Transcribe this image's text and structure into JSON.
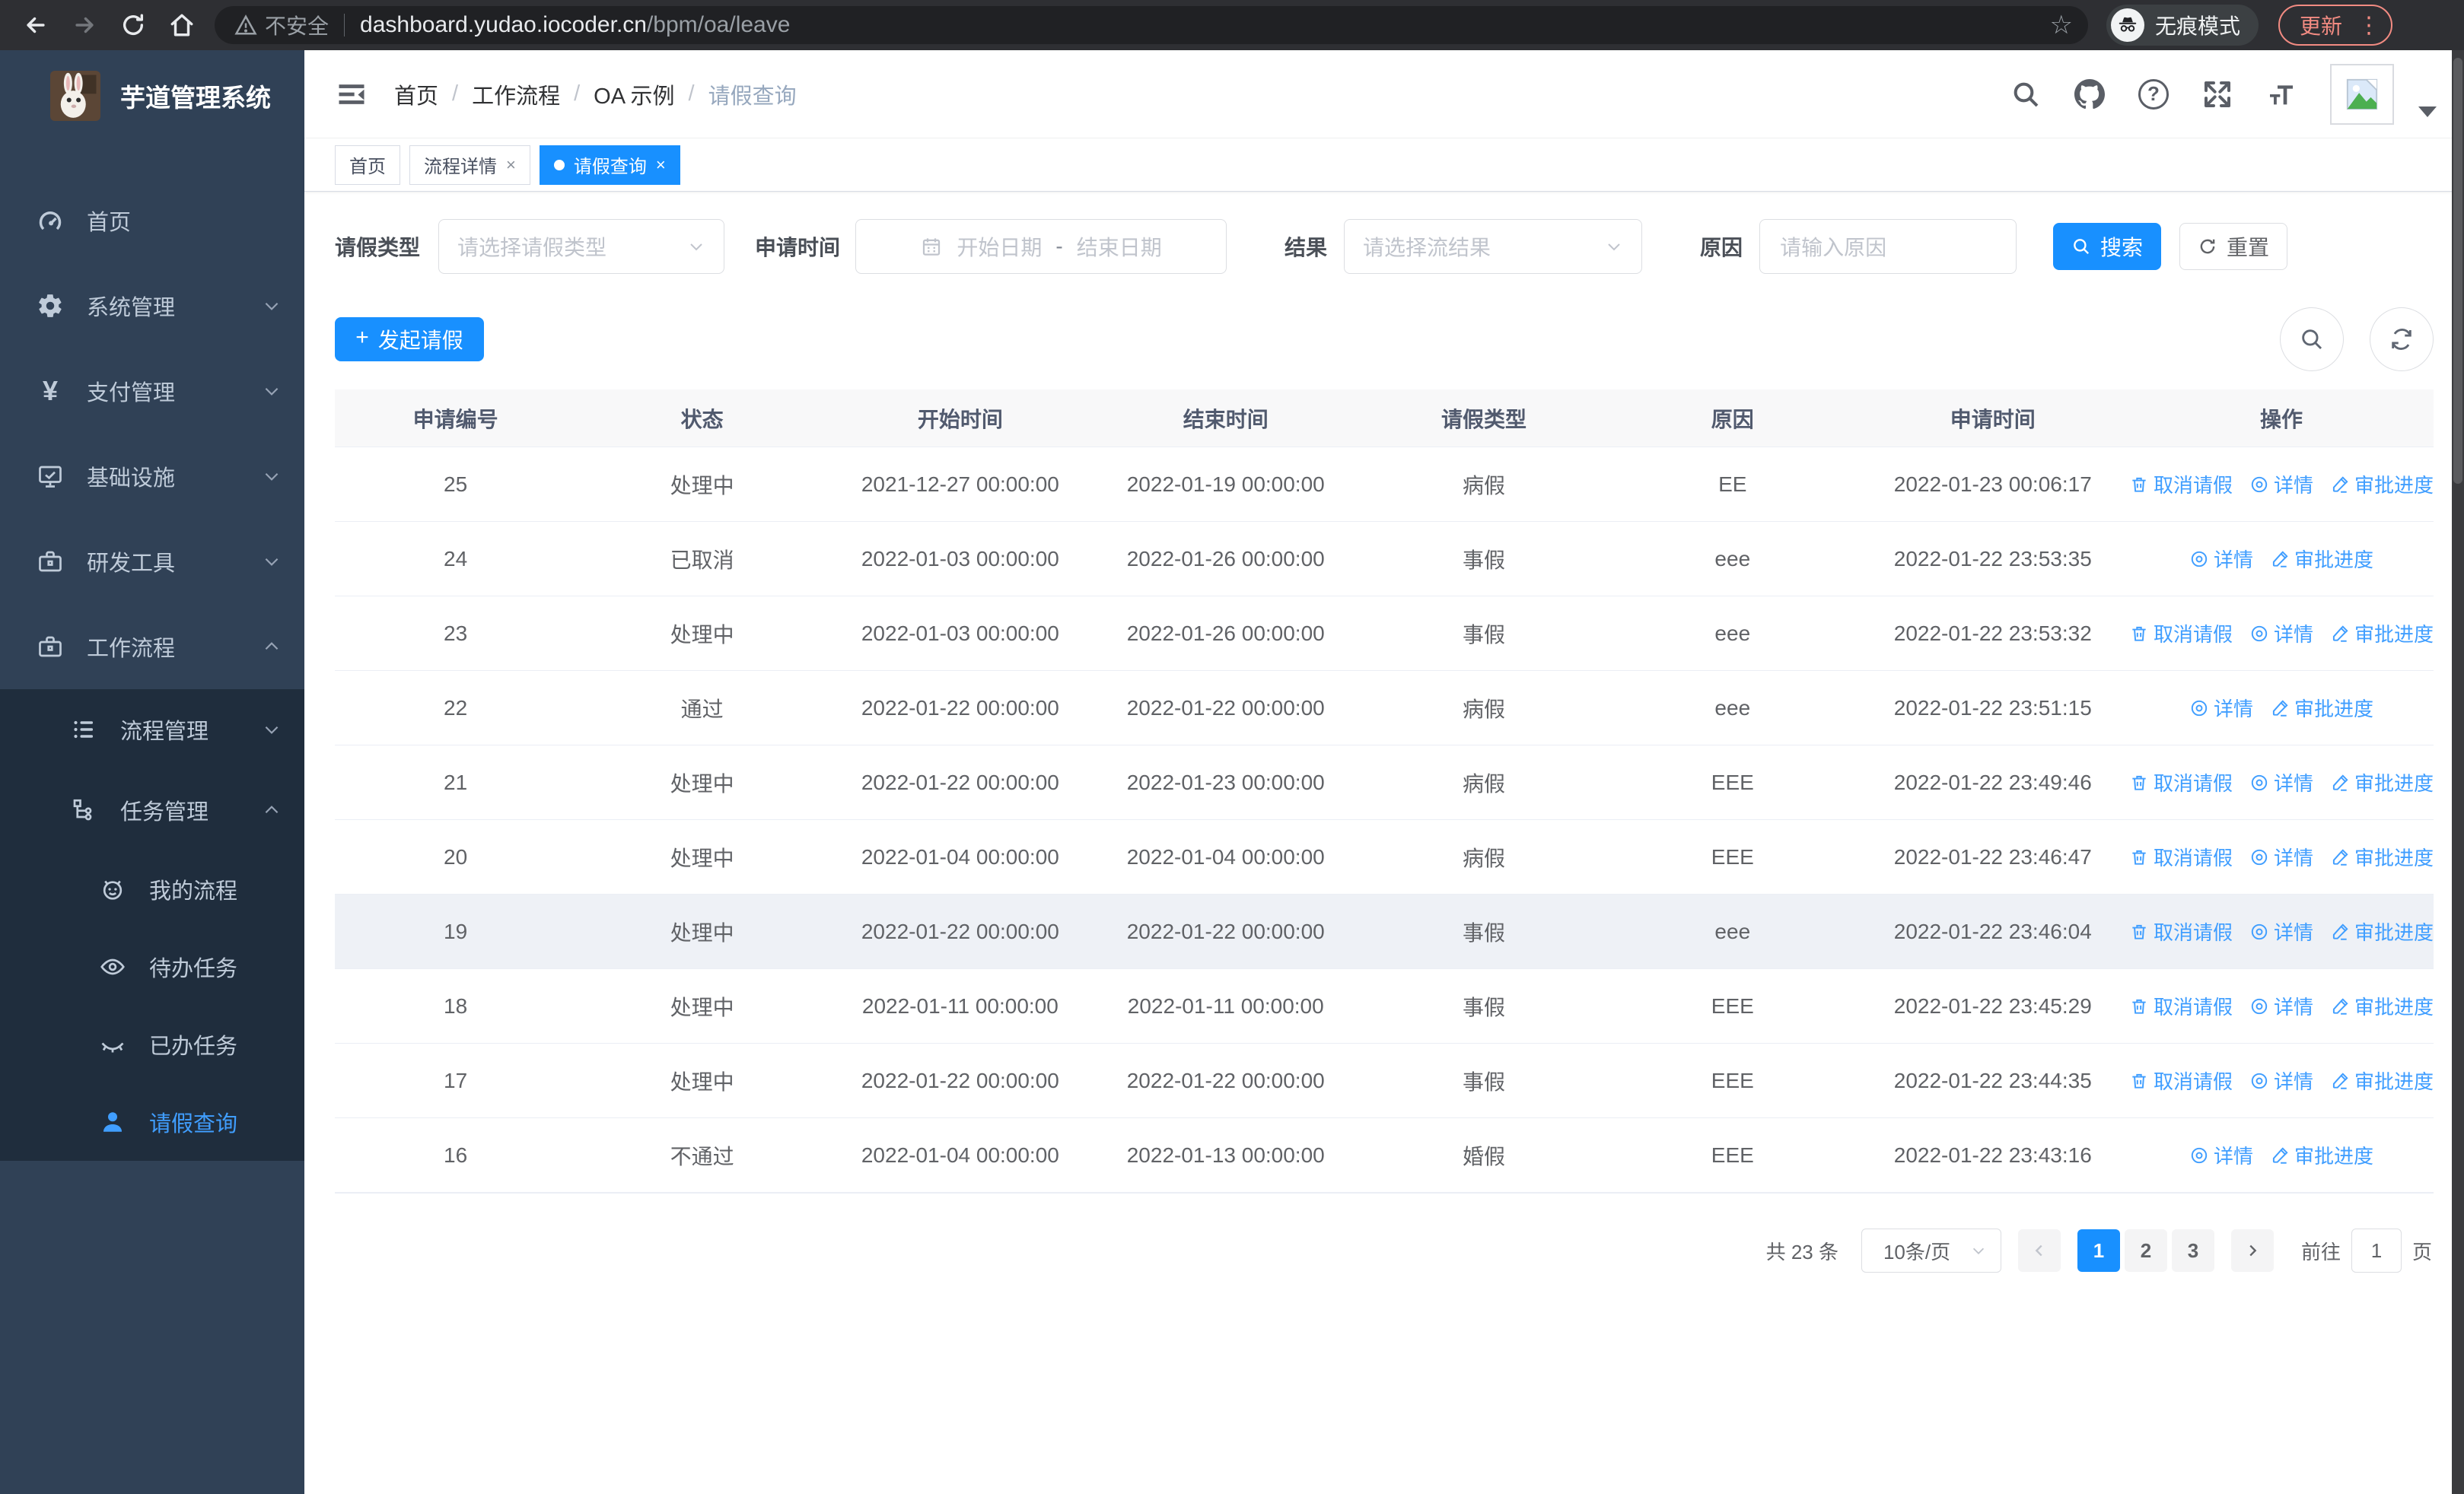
{
  "browser": {
    "security_label": "不安全",
    "url_host": "dashboard.yudao.iocoder.cn",
    "url_path": "/bpm/oa/leave",
    "incognito_label": "无痕模式",
    "update_label": "更新"
  },
  "sidebar": {
    "logo_title": "芋道管理系统",
    "items": [
      {
        "label": "首页",
        "icon": "dashboard-icon",
        "caret": "none",
        "level": 1
      },
      {
        "label": "系统管理",
        "icon": "gear-icon",
        "caret": "down",
        "level": 1
      },
      {
        "label": "支付管理",
        "icon": "yen-icon",
        "caret": "down",
        "level": 1
      },
      {
        "label": "基础设施",
        "icon": "monitor-icon",
        "caret": "down",
        "level": 1
      },
      {
        "label": "研发工具",
        "icon": "briefcase-icon",
        "caret": "down",
        "level": 1
      },
      {
        "label": "工作流程",
        "icon": "briefcase-icon",
        "caret": "up",
        "level": 1
      },
      {
        "label": "流程管理",
        "icon": "list-icon",
        "caret": "down",
        "level": 2
      },
      {
        "label": "任务管理",
        "icon": "tree-icon",
        "caret": "up",
        "level": 2
      },
      {
        "label": "我的流程",
        "icon": "robot-icon",
        "caret": "none",
        "level": 3
      },
      {
        "label": "待办任务",
        "icon": "eye-open-icon",
        "caret": "none",
        "level": 3
      },
      {
        "label": "已办任务",
        "icon": "eye-closed-icon",
        "caret": "none",
        "level": 3
      },
      {
        "label": "请假查询",
        "icon": "user-icon",
        "caret": "none",
        "level": 3,
        "active": true
      }
    ]
  },
  "breadcrumb": [
    "首页",
    "工作流程",
    "OA 示例",
    "请假查询"
  ],
  "tabs": [
    {
      "label": "首页",
      "closable": false,
      "active": false
    },
    {
      "label": "流程详情",
      "closable": true,
      "active": false
    },
    {
      "label": "请假查询",
      "closable": true,
      "active": true
    }
  ],
  "filters": {
    "leave_type_label": "请假类型",
    "leave_type_placeholder": "请选择请假类型",
    "apply_time_label": "申请时间",
    "date_start_placeholder": "开始日期",
    "date_separator": "-",
    "date_end_placeholder": "结束日期",
    "result_label": "结果",
    "result_placeholder": "请选择流结果",
    "reason_label": "原因",
    "reason_placeholder": "请输入原因",
    "search_label": "搜索",
    "reset_label": "重置"
  },
  "toolbar": {
    "create_label": "发起请假"
  },
  "table": {
    "columns": [
      "申请编号",
      "状态",
      "开始时间",
      "结束时间",
      "请假类型",
      "原因",
      "申请时间",
      "操作"
    ],
    "action_labels": {
      "cancel": "取消请假",
      "detail": "详情",
      "progress": "审批进度"
    },
    "rows": [
      {
        "id": "25",
        "status": "处理中",
        "start": "2021-12-27 00:00:00",
        "end": "2022-01-19 00:00:00",
        "type": "病假",
        "reason": "EE",
        "apply_time": "2022-01-23 00:06:17",
        "actions": [
          "cancel",
          "detail",
          "progress"
        ],
        "highlight": false
      },
      {
        "id": "24",
        "status": "已取消",
        "start": "2022-01-03 00:00:00",
        "end": "2022-01-26 00:00:00",
        "type": "事假",
        "reason": "eee",
        "apply_time": "2022-01-22 23:53:35",
        "actions": [
          "detail",
          "progress"
        ],
        "highlight": false
      },
      {
        "id": "23",
        "status": "处理中",
        "start": "2022-01-03 00:00:00",
        "end": "2022-01-26 00:00:00",
        "type": "事假",
        "reason": "eee",
        "apply_time": "2022-01-22 23:53:32",
        "actions": [
          "cancel",
          "detail",
          "progress"
        ],
        "highlight": false
      },
      {
        "id": "22",
        "status": "通过",
        "start": "2022-01-22 00:00:00",
        "end": "2022-01-22 00:00:00",
        "type": "病假",
        "reason": "eee",
        "apply_time": "2022-01-22 23:51:15",
        "actions": [
          "detail",
          "progress"
        ],
        "highlight": false
      },
      {
        "id": "21",
        "status": "处理中",
        "start": "2022-01-22 00:00:00",
        "end": "2022-01-23 00:00:00",
        "type": "病假",
        "reason": "EEE",
        "apply_time": "2022-01-22 23:49:46",
        "actions": [
          "cancel",
          "detail",
          "progress"
        ],
        "highlight": false
      },
      {
        "id": "20",
        "status": "处理中",
        "start": "2022-01-04 00:00:00",
        "end": "2022-01-04 00:00:00",
        "type": "病假",
        "reason": "EEE",
        "apply_time": "2022-01-22 23:46:47",
        "actions": [
          "cancel",
          "detail",
          "progress"
        ],
        "highlight": false
      },
      {
        "id": "19",
        "status": "处理中",
        "start": "2022-01-22 00:00:00",
        "end": "2022-01-22 00:00:00",
        "type": "事假",
        "reason": "eee",
        "apply_time": "2022-01-22 23:46:04",
        "actions": [
          "cancel",
          "detail",
          "progress"
        ],
        "highlight": true
      },
      {
        "id": "18",
        "status": "处理中",
        "start": "2022-01-11 00:00:00",
        "end": "2022-01-11 00:00:00",
        "type": "事假",
        "reason": "EEE",
        "apply_time": "2022-01-22 23:45:29",
        "actions": [
          "cancel",
          "detail",
          "progress"
        ],
        "highlight": false
      },
      {
        "id": "17",
        "status": "处理中",
        "start": "2022-01-22 00:00:00",
        "end": "2022-01-22 00:00:00",
        "type": "事假",
        "reason": "EEE",
        "apply_time": "2022-01-22 23:44:35",
        "actions": [
          "cancel",
          "detail",
          "progress"
        ],
        "highlight": false
      },
      {
        "id": "16",
        "status": "不通过",
        "start": "2022-01-04 00:00:00",
        "end": "2022-01-13 00:00:00",
        "type": "婚假",
        "reason": "EEE",
        "apply_time": "2022-01-22 23:43:16",
        "actions": [
          "detail",
          "progress"
        ],
        "highlight": false
      }
    ]
  },
  "pagination": {
    "total_label": "共 23 条",
    "page_size_value": "10条/页",
    "pages": [
      "1",
      "2",
      "3"
    ],
    "active_page": "1",
    "goto_label": "前往",
    "goto_value": "1",
    "page_unit": "页"
  },
  "colors": {
    "primary": "#1890ff",
    "link": "#409eff",
    "sidebar_bg": "#304156",
    "submenu_bg": "#1f2d3d"
  }
}
